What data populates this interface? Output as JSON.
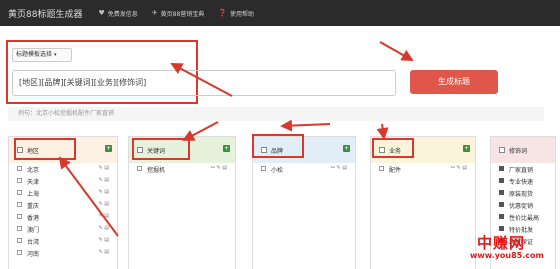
{
  "navbar": {
    "brand": "黄页88标题生成器",
    "items": [
      {
        "label": "免费发信息",
        "icon": "heart-icon"
      },
      {
        "label": "黄页88营销宝典",
        "icon": "plane-icon"
      },
      {
        "label": "使用帮助",
        "icon": "help-icon"
      }
    ]
  },
  "template_select": {
    "label": "标题模板选择"
  },
  "title_input": {
    "value": "[地区][品牌][关键词][业务][修饰词]"
  },
  "generate_button": {
    "label": "生成标题"
  },
  "example": "例句：北京小松挖掘机配件厂家直销",
  "panels": {
    "region": {
      "title": "地区",
      "items": [
        "北京",
        "天津",
        "上海",
        "重庆",
        "香港",
        "澳门",
        "台湾",
        "河南"
      ]
    },
    "keyword": {
      "title": "关键词",
      "items": [
        "挖掘机"
      ]
    },
    "brand": {
      "title": "品牌",
      "items": [
        "小松"
      ]
    },
    "business": {
      "title": "业务",
      "items": [
        "配件"
      ]
    },
    "modifier": {
      "title": "修饰词",
      "items": [
        "厂家直销",
        "专业快速",
        "原装现货",
        "优惠促销",
        "性价比最高",
        "特价批发",
        "质量保证"
      ]
    }
  },
  "watermark": {
    "cn": "中赚网",
    "url": "www.you85.com"
  },
  "colors": {
    "annotation": "#d9392c",
    "generate_button": "#e0564a",
    "navbar": "#2b2b2b"
  }
}
